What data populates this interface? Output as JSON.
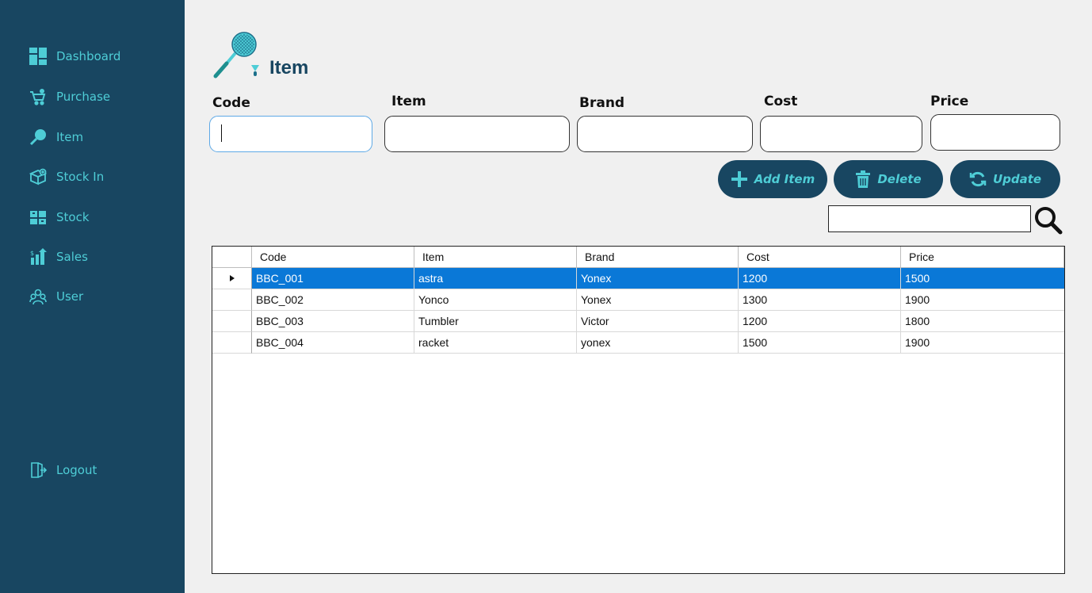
{
  "sidebar": {
    "items": [
      {
        "label": "Dashboard",
        "icon": "dashboard-icon"
      },
      {
        "label": "Purchase",
        "icon": "cart-icon"
      },
      {
        "label": "Item",
        "icon": "racket-icon"
      },
      {
        "label": "Stock In",
        "icon": "box-icon"
      },
      {
        "label": "Stock",
        "icon": "warehouse-icon"
      },
      {
        "label": "Sales",
        "icon": "sales-chart-icon"
      },
      {
        "label": "User",
        "icon": "users-icon"
      }
    ],
    "logout": {
      "label": "Logout",
      "icon": "logout-icon"
    }
  },
  "header": {
    "title": "Item",
    "icon": "badminton-icon"
  },
  "form": {
    "code_label": "Code",
    "item_label": "Item",
    "brand_label": "Brand",
    "cost_label": "Cost",
    "price_label": "Price",
    "code_value": "",
    "item_value": "",
    "brand_value": "",
    "cost_value": "",
    "price_value": ""
  },
  "buttons": {
    "add_label": "Add Item",
    "delete_label": "Delete",
    "update_label": "Update"
  },
  "search": {
    "value": "",
    "icon": "search-icon"
  },
  "table": {
    "columns": [
      "Code",
      "Item",
      "Brand",
      "Cost",
      "Price"
    ],
    "rows": [
      [
        "BBC_001",
        "astra",
        "Yonex",
        "1200",
        "1500"
      ],
      [
        "BBC_002",
        "Yonco",
        "Yonex",
        "1300",
        "1900"
      ],
      [
        "BBC_003",
        "Tumbler",
        "Victor",
        "1200",
        "1800"
      ],
      [
        "BBC_004",
        "racket",
        "yonex",
        "1500",
        "1900"
      ]
    ],
    "selected_row": 0
  },
  "colors": {
    "sidebar_bg": "#184661",
    "accent": "#4ecdd6",
    "selection": "#0a78d7"
  }
}
